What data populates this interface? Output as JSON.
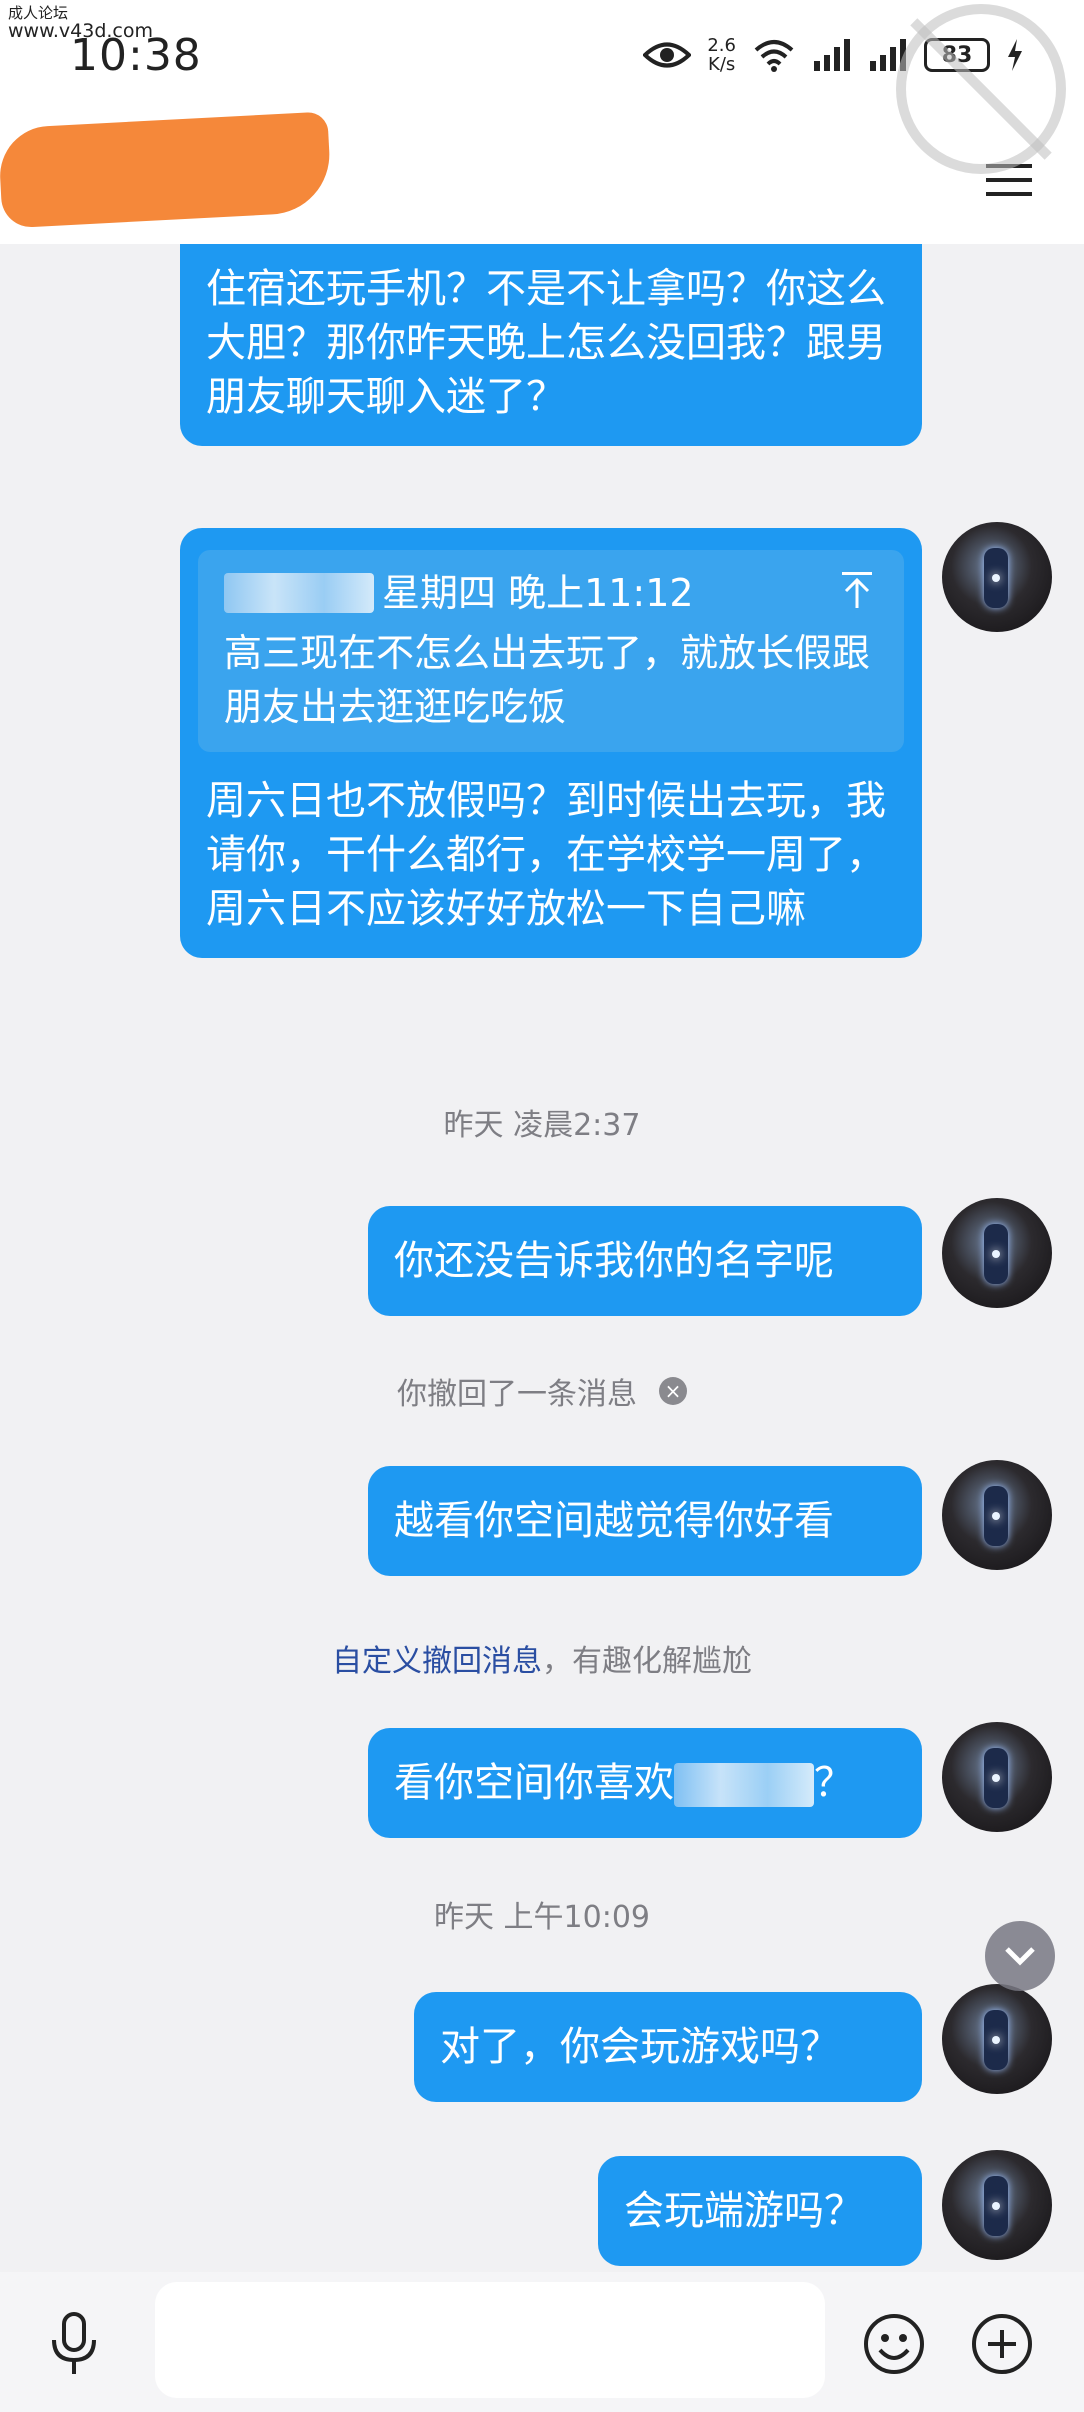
{
  "watermark_site": {
    "line1": "成人论坛",
    "line2": "www.v43d.com"
  },
  "status_bar": {
    "time": "10:38",
    "net_speed_top": "2.6",
    "net_speed_bottom": "K/s",
    "battery": "83"
  },
  "messages": {
    "bubble1": "住宿还玩手机？不是不让拿吗？你这么大胆？那你昨天晚上怎么没回我？跟男朋友聊天聊入迷了？",
    "bubble2": {
      "quote_time": "星期四 晚上11:12",
      "quote_text": "高三现在不怎么出去玩了，就放长假跟朋友出去逛逛吃吃饭",
      "text": "周六日也不放假吗？到时候出去玩，我请你，干什么都行，在学校学一周了，周六日不应该好好放松一下自己嘛"
    },
    "timestamp1": "昨天 凌晨2:37",
    "bubble3": "你还没告诉我你的名字呢",
    "recalled_notice": "你撤回了一条消息",
    "bubble4": "越看你空间越觉得你好看",
    "hint_link": "自定义撤回消息",
    "hint_rest": "，有趣化解尴尬",
    "bubble5_prefix": "看你空间你喜欢",
    "bubble5_suffix": "？",
    "timestamp2": "昨天 上午10:09",
    "bubble6": "对了，你会玩游戏吗？",
    "bubble7": "会玩端游吗？"
  },
  "input": {
    "placeholder": ""
  },
  "colors": {
    "bubble": "#1e99f2",
    "background": "#f1f1f3",
    "redaction": "#f5883a",
    "hint_link": "#2a4ea2"
  }
}
